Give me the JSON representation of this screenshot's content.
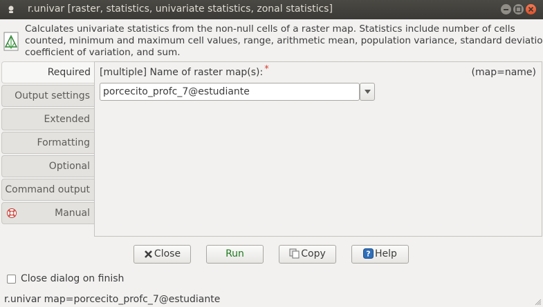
{
  "window": {
    "title": "r.univar [raster, statistics, univariate statistics, zonal statistics]"
  },
  "description": {
    "line1": "Calculates univariate statistics from the non-null cells of a raster map. Statistics include number of cells",
    "line2": "counted, minimum and maximum cell values, range, arithmetic mean, population variance, standard deviation,",
    "line3": "coefficient of variation, and sum."
  },
  "tabs": [
    {
      "label": "Required",
      "active": true
    },
    {
      "label": "Output settings"
    },
    {
      "label": "Extended"
    },
    {
      "label": "Formatting"
    },
    {
      "label": "Optional"
    },
    {
      "label": "Command output"
    },
    {
      "label": "Manual",
      "icon": "lifebuoy-icon"
    }
  ],
  "required": {
    "map_label": "[multiple] Name of raster map(s):",
    "required_marker": "*",
    "map_key": "(map=name)",
    "map_value": "porcecito_profc_7@estudiante"
  },
  "buttons": {
    "close": "Close",
    "run": "Run",
    "copy": "Copy",
    "help": "Help"
  },
  "close_on_finish": {
    "label": "Close dialog on finish",
    "checked": false
  },
  "statusbar": {
    "command": "r.univar map=porcecito_profc_7@estudiante"
  },
  "colors": {
    "titlebar": "#3b3a36",
    "close_button": "#e0522a",
    "run_text": "#1e7a1e",
    "required_marker": "#d43c2a"
  }
}
